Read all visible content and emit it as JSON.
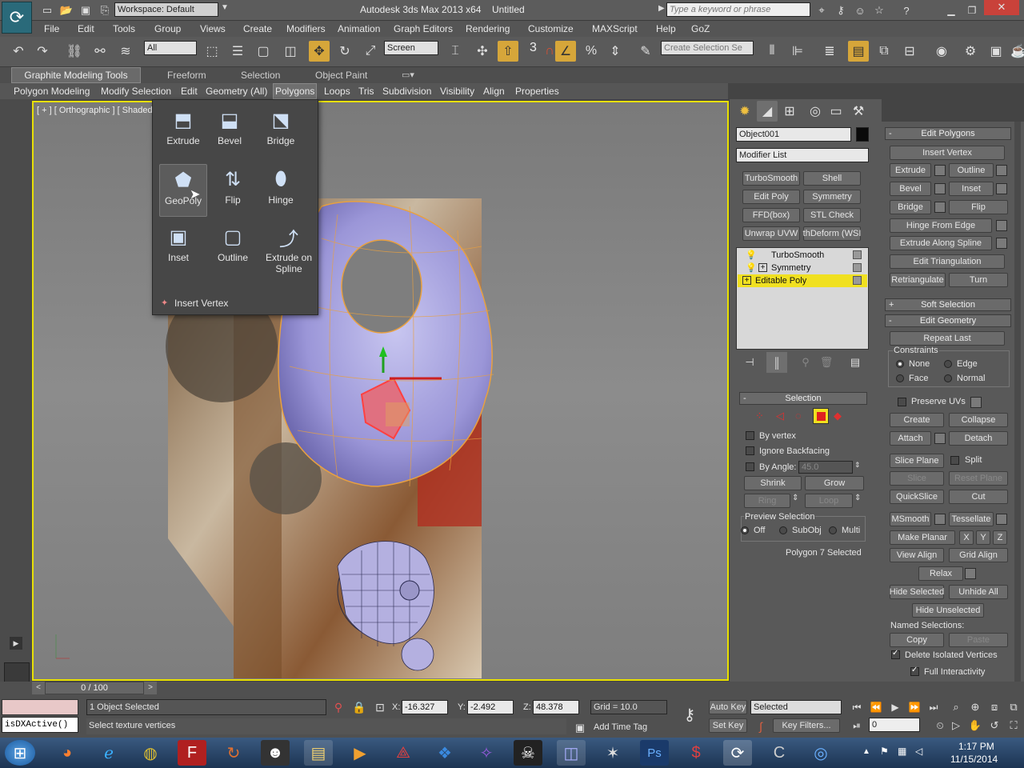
{
  "titlebar": {
    "workspace": "Workspace: Default",
    "app_title": "Autodesk 3ds Max  2013 x64",
    "doc_title": "Untitled",
    "search_placeholder": "Type a keyword or phrase"
  },
  "menus": [
    "File",
    "Edit",
    "Tools",
    "Group",
    "Views",
    "Create",
    "Modifiers",
    "Animation",
    "Graph Editors",
    "Rendering",
    "Customize",
    "MAXScript",
    "Help",
    "GoZ"
  ],
  "toolbar": {
    "filter": "All",
    "coord": "Screen",
    "selection_set_placeholder": "Create Selection Se",
    "snap_label": "3"
  },
  "ribbon": {
    "tabs": [
      "Graphite Modeling Tools",
      "Freeform",
      "Selection",
      "Object Paint"
    ],
    "subtabs": [
      "Polygon Modeling",
      "Modify Selection",
      "Edit",
      "Geometry (All)",
      "Polygons",
      "Loops",
      "Tris",
      "Subdivision",
      "Visibility",
      "Align",
      "Properties"
    ],
    "active_subtab": "Polygons"
  },
  "viewport": {
    "label": "[ + ] [ Orthographic ] [ Shaded"
  },
  "flyout": {
    "items": [
      [
        "Extrude",
        "Bevel",
        "Bridge"
      ],
      [
        "GeoPoly",
        "Flip",
        "Hinge"
      ],
      [
        "Inset",
        "Outline",
        "Extrude on Spline"
      ]
    ],
    "insert_vertex": "Insert Vertex"
  },
  "command_panel": {
    "object_name": "Object001",
    "modifier_list": "Modifier List",
    "modifier_buttons": [
      "TurboSmooth",
      "Shell",
      "Edit Poly",
      "Symmetry",
      "FFD(box)",
      "STL Check",
      "Unwrap UVW",
      "thDeform (WSI"
    ],
    "stack": [
      "TurboSmooth",
      "Symmetry",
      "Editable Poly"
    ],
    "selection": {
      "title": "Selection",
      "by_vertex": "By vertex",
      "ignore_backfacing": "Ignore Backfacing",
      "by_angle": "By Angle:",
      "angle_value": "45.0",
      "shrink": "Shrink",
      "grow": "Grow",
      "ring": "Ring",
      "loop": "Loop",
      "preview_selection": "Preview Selection",
      "off": "Off",
      "subobj": "SubObj",
      "multi": "Multi",
      "status": "Polygon 7 Selected"
    }
  },
  "edit_panel": {
    "edit_polygons": "Edit Polygons",
    "insert_vertex": "Insert Vertex",
    "extrude": "Extrude",
    "outline": "Outline",
    "bevel": "Bevel",
    "inset": "Inset",
    "bridge": "Bridge",
    "flip": "Flip",
    "hinge_from_edge": "Hinge From Edge",
    "extrude_along_spline": "Extrude Along Spline",
    "edit_triangulation": "Edit Triangulation",
    "retriangulate": "Retriangulate",
    "turn": "Turn",
    "soft_selection": "Soft Selection",
    "edit_geometry": "Edit Geometry",
    "repeat_last": "Repeat Last",
    "constraints": "Constraints",
    "none": "None",
    "edge": "Edge",
    "face": "Face",
    "normal": "Normal",
    "preserve_uvs": "Preserve UVs",
    "create": "Create",
    "collapse": "Collapse",
    "attach": "Attach",
    "detach": "Detach",
    "slice_plane": "Slice Plane",
    "split": "Split",
    "slice": "Slice",
    "reset_plane": "Reset Plane",
    "quickslice": "QuickSlice",
    "cut": "Cut",
    "msmooth": "MSmooth",
    "tessellate": "Tessellate",
    "make_planar": "Make Planar",
    "x": "X",
    "y": "Y",
    "z": "Z",
    "view_align": "View Align",
    "grid_align": "Grid Align",
    "relax": "Relax",
    "hide_selected": "Hide Selected",
    "unhide_all": "Unhide All",
    "hide_unselected": "Hide Unselected",
    "named_selections": "Named Selections:",
    "copy": "Copy",
    "paste": "Paste",
    "delete_isolated": "Delete Isolated Vertices",
    "full_interactivity": "Full Interactivity"
  },
  "bottom": {
    "frame": "0 / 100",
    "status1": "1 Object Selected",
    "status2": "Select texture vertices",
    "script": "isDXActive()",
    "x_label": "X:",
    "x": "-16.327",
    "y_label": "Y:",
    "y": "-2.492",
    "z_label": "Z:",
    "z": "48.378",
    "grid": "Grid = 10.0",
    "add_time_tag": "Add Time Tag",
    "auto_key": "Auto Key",
    "selected": "Selected",
    "set_key": "Set Key",
    "key_filters": "Key Filters...",
    "frame_field": "0"
  },
  "taskbar": {
    "time": "1:17 PM",
    "date": "11/15/2014"
  }
}
